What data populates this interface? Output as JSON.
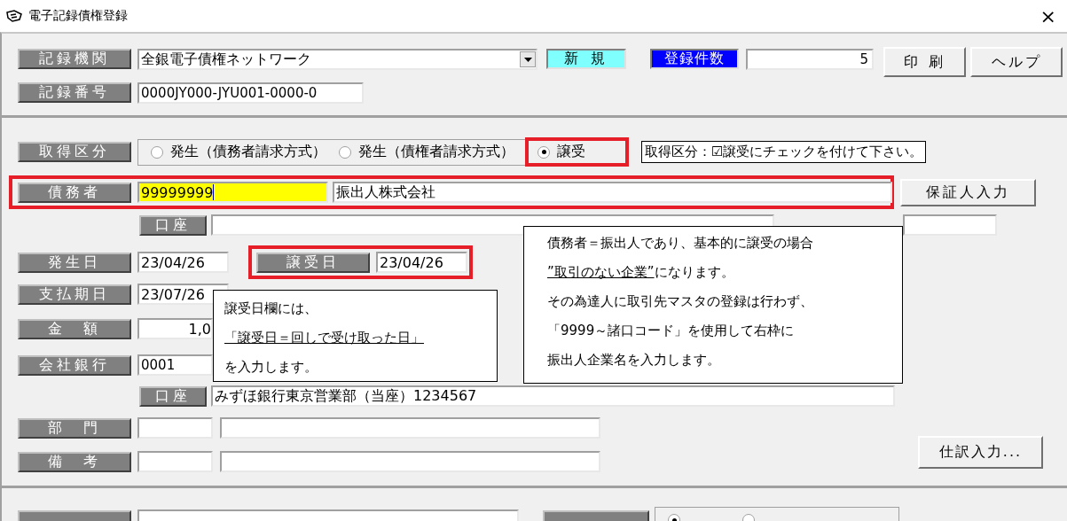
{
  "window": {
    "title": "電子記録債権登録",
    "close": "×"
  },
  "header": {
    "institution": {
      "label": "記録機関",
      "value": "全銀電子債権ネットワーク"
    },
    "mode": "新 規",
    "count": {
      "label": "登録件数",
      "value": "5"
    },
    "record_number": {
      "label": "記録番号",
      "value": "0000JY000-JYU001-0000-0"
    },
    "buttons": [
      "印 刷",
      "ヘルプ"
    ]
  },
  "acquisition": {
    "label": "取得区分",
    "options": [
      {
        "label": "発生（債務者請求方式）",
        "selected": false,
        "highlighted": false
      },
      {
        "label": "発生（債権者請求方式）",
        "selected": false,
        "highlighted": false
      },
      {
        "label": "譲受",
        "selected": true,
        "highlighted": true
      }
    ],
    "note": "取得区分：☑譲受にチェックを付けて下さい。"
  },
  "debtor": {
    "label": "債務者",
    "code": "99999999",
    "name": "振出人株式会社",
    "highlighted": true,
    "button": "保証人入力"
  },
  "debtor_account": {
    "label": "口座"
  },
  "issue_date": {
    "label": "発生日",
    "value": "23/04/26"
  },
  "transfer_date": {
    "label": "譲受日",
    "value": "23/04/26",
    "highlighted": true
  },
  "due_date": {
    "label": "支払期日",
    "value": "23/07/26"
  },
  "amount": {
    "label": "金　額",
    "value": "1,0"
  },
  "company_bank": {
    "label": "会社銀行",
    "value": "0001"
  },
  "company_account": {
    "label": "口座",
    "value": "みずほ銀行東京営業部（当座）1234567"
  },
  "department": {
    "label": "部　門"
  },
  "remarks": {
    "label": "備　考"
  },
  "journal_button": "仕訳入力...",
  "footer": {
    "options": [
      {
        "selected": true
      },
      {
        "selected": false
      }
    ]
  },
  "callouts": [
    {
      "lines": [
        [
          {
            "text": "譲受日欄には、",
            "underline": false
          }
        ],
        [
          {
            "text": "「譲受日＝回しで受け取った日」",
            "underline": true
          }
        ],
        [
          {
            "text": "を入力します。",
            "underline": false
          }
        ]
      ]
    },
    {
      "lines": [
        [
          {
            "text": "債務者＝振出人であり、基本的に譲受の場合",
            "underline": false
          }
        ],
        [
          {
            "text": "”取引のない企業”",
            "underline": true
          },
          {
            "text": "になります。",
            "underline": false
          }
        ],
        [
          {
            "text": "その為達人に取引先マスタの登録は行わず、",
            "underline": false
          }
        ],
        [
          {
            "text": "「9999～諸口コード」を使用して右枠に",
            "underline": false
          }
        ],
        [
          {
            "text": "振出人企業名を入力します。",
            "underline": false
          }
        ]
      ]
    }
  ]
}
